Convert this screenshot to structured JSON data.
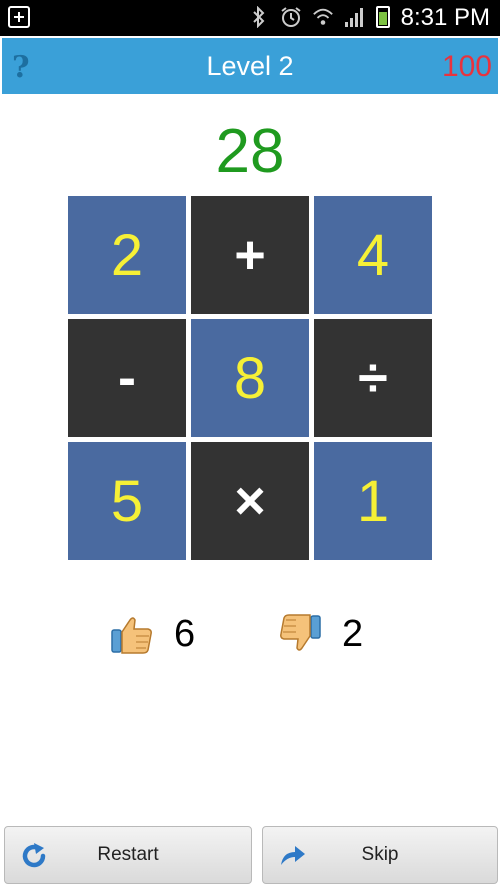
{
  "status_bar": {
    "time": "8:31 PM",
    "icons": [
      "plus-box-icon",
      "bluetooth-icon",
      "alarm-icon",
      "wifi-icon",
      "signal-icon",
      "battery-charging-icon"
    ]
  },
  "header": {
    "help_icon": "question-mark-icon",
    "title": "Level 2",
    "score": "100"
  },
  "target": "28",
  "grid": [
    {
      "text": "2",
      "kind": "number"
    },
    {
      "text": "+",
      "kind": "operator"
    },
    {
      "text": "4",
      "kind": "number"
    },
    {
      "text": "-",
      "kind": "operator"
    },
    {
      "text": "8",
      "kind": "number"
    },
    {
      "text": "÷",
      "kind": "operator"
    },
    {
      "text": "5",
      "kind": "number"
    },
    {
      "text": "×",
      "kind": "operator"
    },
    {
      "text": "1",
      "kind": "number"
    }
  ],
  "stats": {
    "thumbs_up_icon": "thumbs-up-icon",
    "thumbs_up_count": "6",
    "thumbs_down_icon": "thumbs-down-icon",
    "thumbs_down_count": "2"
  },
  "buttons": {
    "restart_label": "Restart",
    "restart_icon": "refresh-icon",
    "skip_label": "Skip",
    "skip_icon": "forward-arrow-icon"
  },
  "colors": {
    "header_bg": "#3aa0d8",
    "score": "#e8333e",
    "target": "#1f9a1f",
    "number_tile": "#4a6aa0",
    "operator_tile": "#333333",
    "number_text": "#f6f036"
  }
}
